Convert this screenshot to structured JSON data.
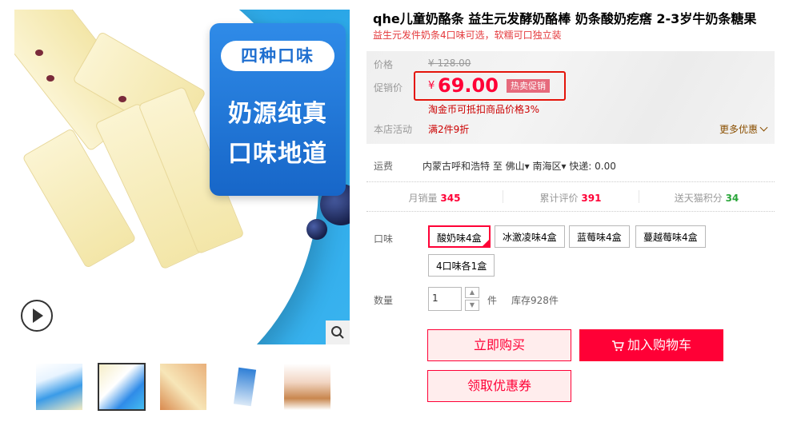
{
  "gallery": {
    "badge_top": "四种口味",
    "badge_line1": "奶源纯真",
    "badge_line2": "口味地道",
    "play_icon": "play-icon",
    "zoom_icon": "magnifier-icon",
    "thumbnails": [
      "thumb-1",
      "thumb-2",
      "thumb-3",
      "thumb-4",
      "thumb-5"
    ],
    "active_thumbnail_index": 1
  },
  "product": {
    "title": "qhe儿童奶酪条 益生元发酵奶酪棒 奶条酸奶疙瘩 2-3岁牛奶条糖果",
    "subtitle": "益生元发件奶条4口味可选，软糯可口独立装"
  },
  "price": {
    "label": "价格",
    "original": "¥ 128.00",
    "promo_label": "促销价",
    "currency": "¥",
    "promo_value": "69.00",
    "promo_tag": "热卖促销",
    "coin_note": "淘金币可抵扣商品价格3%",
    "event_label": "本店活动",
    "event_text": "满2件9折",
    "more_link": "更多优惠"
  },
  "shipping": {
    "label": "运费",
    "text": "内蒙古呼和浩特  至  佛山▾ 南海区▾  快递: 0.00"
  },
  "stats": {
    "monthly_sales_label": "月销量",
    "monthly_sales": "345",
    "reviews_label": "累计评价",
    "reviews": "391",
    "points_label": "送天猫积分",
    "points": "34"
  },
  "flavor": {
    "label": "口味",
    "options": [
      "酸奶味4盒",
      "冰激凌味4盒",
      "蓝莓味4盒",
      "蔓越莓味4盒",
      "4口味各1盒"
    ],
    "selected_index": 0
  },
  "quantity": {
    "label": "数量",
    "value": "1",
    "increase": "▲",
    "decrease": "▼",
    "unit": "件",
    "stock": "库存928件"
  },
  "actions": {
    "buy_now": "立即购买",
    "add_to_cart": "加入购物车",
    "get_coupon": "领取优惠券"
  },
  "colors": {
    "accent": "#ff0036",
    "promo_frame": "#e4140a",
    "promo_tag_bg": "#e66a7c",
    "points_green": "#2aa63a"
  }
}
